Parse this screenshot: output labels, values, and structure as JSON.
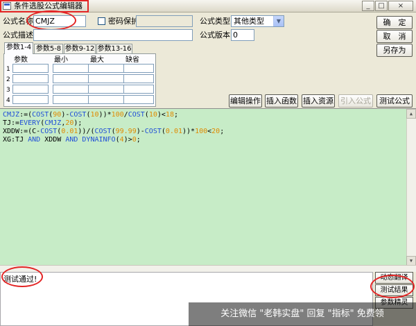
{
  "window": {
    "title": "条件选股公式编辑器",
    "controls": {
      "minimize": "_",
      "maximize": "□",
      "close": "×"
    }
  },
  "form": {
    "name_label": "公式名称",
    "name_value": "CMJZ",
    "password_label": "密码保护",
    "password_checked": false,
    "type_label": "公式类型",
    "type_value": "其他类型",
    "desc_label": "公式描述",
    "desc_value": "",
    "version_label": "公式版本",
    "version_value": "0"
  },
  "right_buttons": {
    "ok": "确　定",
    "cancel": "取　消",
    "save_as": "另存为"
  },
  "tabs": [
    {
      "label": "参数1-4",
      "active": true
    },
    {
      "label": "参数5-8",
      "active": false
    },
    {
      "label": "参数9-12",
      "active": false
    },
    {
      "label": "参数13-16",
      "active": false
    }
  ],
  "param_table": {
    "headers": [
      "参数",
      "最小",
      "最大",
      "缺省"
    ],
    "row_numbers": [
      "1",
      "2",
      "3",
      "4"
    ]
  },
  "toolbar": {
    "edit_ops": "编辑操作",
    "insert_func": "插入函数",
    "insert_resource": "插入资源",
    "import_formula": "引入公式",
    "test_formula": "测试公式"
  },
  "code_lines": [
    [
      {
        "t": "CMJZ",
        "c": "#1f4ed8"
      },
      {
        "t": ":=(",
        "c": "#000000"
      },
      {
        "t": "COST",
        "c": "#1f4ed8"
      },
      {
        "t": "(",
        "c": "#000000"
      },
      {
        "t": "90",
        "c": "#e08a00"
      },
      {
        "t": ")-",
        "c": "#000000"
      },
      {
        "t": "COST",
        "c": "#1f4ed8"
      },
      {
        "t": "(",
        "c": "#000000"
      },
      {
        "t": "10",
        "c": "#e08a00"
      },
      {
        "t": "))*",
        "c": "#000000"
      },
      {
        "t": "100",
        "c": "#e08a00"
      },
      {
        "t": "/",
        "c": "#000000"
      },
      {
        "t": "COST",
        "c": "#1f4ed8"
      },
      {
        "t": "(",
        "c": "#000000"
      },
      {
        "t": "10",
        "c": "#e08a00"
      },
      {
        "t": ")<",
        "c": "#000000"
      },
      {
        "t": "18",
        "c": "#e08a00"
      },
      {
        "t": ";",
        "c": "#000000"
      }
    ],
    [
      {
        "t": "TJ:=",
        "c": "#000000"
      },
      {
        "t": "EVERY",
        "c": "#1f4ed8"
      },
      {
        "t": "(",
        "c": "#000000"
      },
      {
        "t": "CMJZ",
        "c": "#1f4ed8"
      },
      {
        "t": ",",
        "c": "#000000"
      },
      {
        "t": "20",
        "c": "#e08a00"
      },
      {
        "t": ");",
        "c": "#000000"
      }
    ],
    [
      {
        "t": "XDDW:=(C-",
        "c": "#000000"
      },
      {
        "t": "COST",
        "c": "#1f4ed8"
      },
      {
        "t": "(",
        "c": "#000000"
      },
      {
        "t": "0.01",
        "c": "#e08a00"
      },
      {
        "t": "))/(",
        "c": "#000000"
      },
      {
        "t": "COST",
        "c": "#1f4ed8"
      },
      {
        "t": "(",
        "c": "#000000"
      },
      {
        "t": "99.99",
        "c": "#e08a00"
      },
      {
        "t": ")-",
        "c": "#000000"
      },
      {
        "t": "COST",
        "c": "#1f4ed8"
      },
      {
        "t": "(",
        "c": "#000000"
      },
      {
        "t": "0.01",
        "c": "#e08a00"
      },
      {
        "t": "))*",
        "c": "#000000"
      },
      {
        "t": "100",
        "c": "#e08a00"
      },
      {
        "t": "<",
        "c": "#000000"
      },
      {
        "t": "20",
        "c": "#e08a00"
      },
      {
        "t": ";",
        "c": "#000000"
      }
    ],
    [
      {
        "t": "XG:TJ ",
        "c": "#000000"
      },
      {
        "t": "AND",
        "c": "#1f4ed8"
      },
      {
        "t": " XDDW ",
        "c": "#000000"
      },
      {
        "t": "AND",
        "c": "#1f4ed8"
      },
      {
        "t": " ",
        "c": "#000000"
      },
      {
        "t": "DYNAINFO",
        "c": "#1f4ed8"
      },
      {
        "t": "(",
        "c": "#000000"
      },
      {
        "t": "4",
        "c": "#e08a00"
      },
      {
        "t": ")>",
        "c": "#000000"
      },
      {
        "t": "0",
        "c": "#e08a00"
      },
      {
        "t": ";",
        "c": "#000000"
      }
    ]
  ],
  "output": {
    "text": "测试通过!"
  },
  "side_buttons": {
    "dynamic_translate": "动态翻译",
    "test_result": "测试结果",
    "param_guide": "参数精灵"
  },
  "watermark": {
    "text": "关注微信 \"老韩实盘\" 回复 \"指标\" 免费领"
  },
  "colors": {
    "editor_bg": "#c7ecc7",
    "highlight": "#e32424",
    "keyword": "#1f4ed8",
    "number": "#e08a00"
  }
}
